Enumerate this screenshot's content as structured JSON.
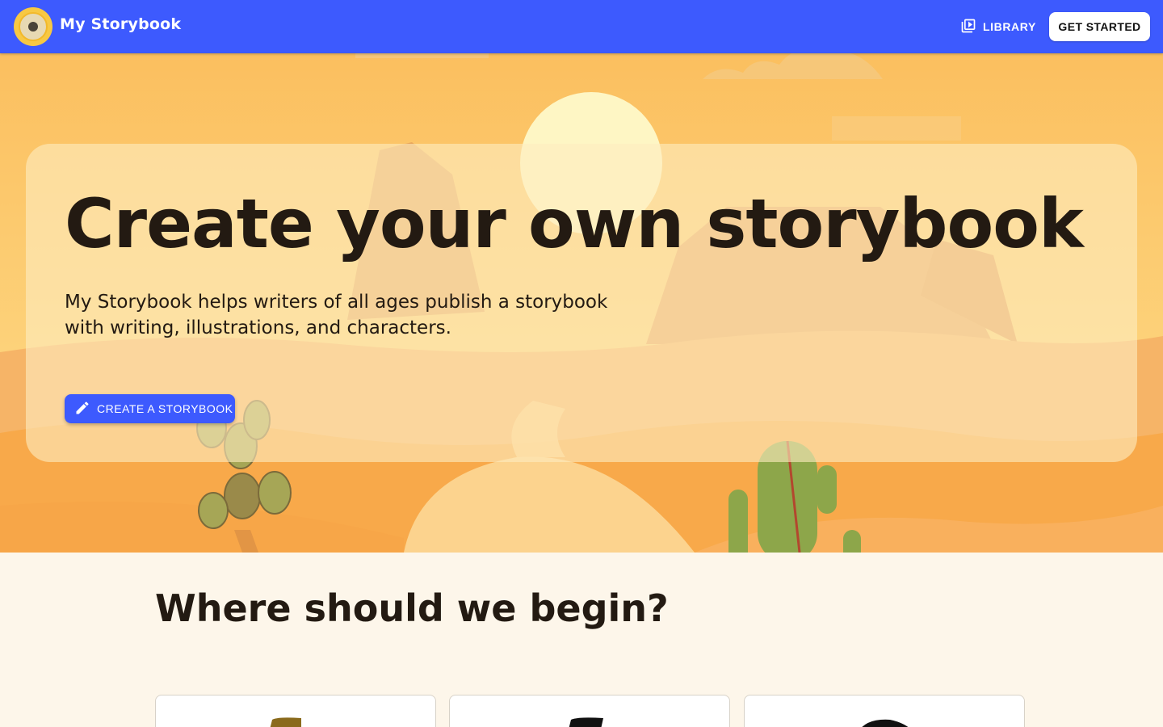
{
  "header": {
    "brand": "My Storybook",
    "library_label": "LIBRARY",
    "get_started_label": "GET STARTED"
  },
  "hero": {
    "title": "Create your own storybook",
    "subtitle": "My Storybook helps writers of all ages publish a storybook with writing, illustrations, and characters.",
    "cta_label": "CREATE A STORYBOOK"
  },
  "section": {
    "title": "Where should we begin?"
  },
  "colors": {
    "primary": "#3d5afe",
    "sky": "#fbbd5e",
    "sand": "#f8a94a",
    "text": "#231a12"
  },
  "icons": {
    "logo": "sunflower-logo-icon",
    "library": "library-books-icon",
    "create": "pencil-icon"
  }
}
